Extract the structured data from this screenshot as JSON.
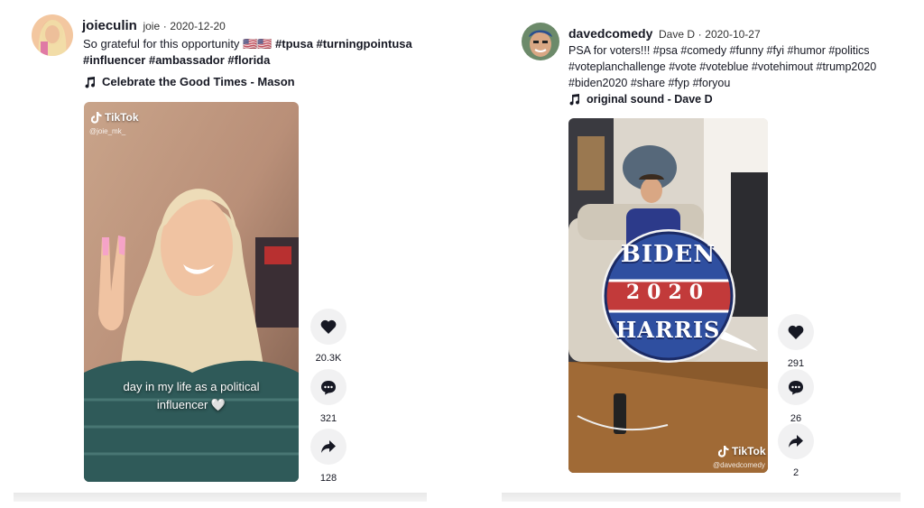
{
  "posts": [
    {
      "username": "joieculin",
      "display_name": "joie",
      "date": "2020-12-20",
      "caption_text": "So grateful for this opportunity 🇺🇸🇺🇸",
      "hashtags_line1": "#tpusa #turningpointusa",
      "hashtags_line2": "#influencer #ambassador #florida",
      "sound": "Celebrate the Good Times - Mason",
      "watermark_brand": "TikTok",
      "watermark_user": "@joie_mk_",
      "overlay_text_line1": "day in my life as a political",
      "overlay_text_line2": "influencer 🤍",
      "likes": "20.3K",
      "comments": "321",
      "shares": "128"
    },
    {
      "username": "davedcomedy",
      "display_name": "Dave D",
      "date": "2020-10-27",
      "caption_line1": "PSA for voters!!! #psa #comedy #funny #fyi #humor #politics",
      "caption_line2": "#voteplanchallenge #vote #voteblue #votehimout #trump2020",
      "caption_line3": "#biden2020 #share #fyp #foryou",
      "sound": "original sound - Dave D",
      "watermark_brand": "TikTok",
      "watermark_user": "@davedcomedy",
      "sticker_top": "BIDEN",
      "sticker_middle": "2020",
      "sticker_bottom": "HARRIS",
      "likes": "291",
      "comments": "26",
      "shares": "2"
    }
  ],
  "icons": [
    "music-note-icon",
    "heart-icon",
    "comment-icon",
    "share-icon",
    "tiktok-logo-icon"
  ]
}
